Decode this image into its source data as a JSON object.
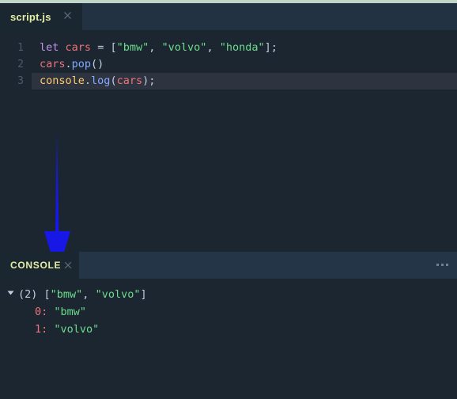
{
  "window": {
    "accent_strip_color": "#bfd6c8",
    "background_color": "#1b2631"
  },
  "editor": {
    "tab": {
      "label": "script.js",
      "close_icon": "close-icon",
      "active": true
    },
    "active_line": 3,
    "lines": [
      {
        "number": "1",
        "tokens": [
          {
            "text": "let",
            "kind": "keyword",
            "color": "#c792ea"
          },
          {
            "text": " ",
            "kind": "space"
          },
          {
            "text": "cars",
            "kind": "variable",
            "color": "#f07178"
          },
          {
            "text": " ",
            "kind": "space"
          },
          {
            "text": "=",
            "kind": "operator",
            "color": "#c3cee3"
          },
          {
            "text": " ",
            "kind": "space"
          },
          {
            "text": "[",
            "kind": "punct",
            "color": "#c3cee3"
          },
          {
            "text": "\"bmw\"",
            "kind": "string",
            "color": "#6ddc8c"
          },
          {
            "text": ",",
            "kind": "punct",
            "color": "#c3cee3"
          },
          {
            "text": " ",
            "kind": "space"
          },
          {
            "text": "\"volvo\"",
            "kind": "string",
            "color": "#6ddc8c"
          },
          {
            "text": ",",
            "kind": "punct",
            "color": "#c3cee3"
          },
          {
            "text": " ",
            "kind": "space"
          },
          {
            "text": "\"honda\"",
            "kind": "string",
            "color": "#6ddc8c"
          },
          {
            "text": "];",
            "kind": "punct",
            "color": "#c3cee3"
          }
        ]
      },
      {
        "number": "2",
        "tokens": [
          {
            "text": "cars",
            "kind": "variable",
            "color": "#f07178"
          },
          {
            "text": ".",
            "kind": "punct",
            "color": "#c3cee3"
          },
          {
            "text": "pop",
            "kind": "function",
            "color": "#82aaff"
          },
          {
            "text": "()",
            "kind": "punct",
            "color": "#c3cee3"
          }
        ]
      },
      {
        "number": "3",
        "tokens": [
          {
            "text": "console",
            "kind": "object",
            "color": "#ffcb6b"
          },
          {
            "text": ".",
            "kind": "punct",
            "color": "#c3cee3"
          },
          {
            "text": "log",
            "kind": "function",
            "color": "#82aaff"
          },
          {
            "text": "(",
            "kind": "punct",
            "color": "#c3cee3"
          },
          {
            "text": "cars",
            "kind": "variable",
            "color": "#f07178"
          },
          {
            "text": ");",
            "kind": "punct",
            "color": "#c3cee3"
          }
        ]
      }
    ]
  },
  "annotation": {
    "arrow": {
      "name": "down-arrow-annotation",
      "direction": "down",
      "color": "#1818e6"
    }
  },
  "console": {
    "tab_label": "CONSOLE",
    "close_icon": "close-icon",
    "overflow_icon": "ellipsis-icon",
    "output": {
      "summary": {
        "disclosure": "expanded",
        "count": "(2)",
        "preview_open": "[",
        "items": [
          "\"bmw\"",
          "\"volvo\""
        ],
        "separator": ", ",
        "preview_close": "]"
      },
      "entries": [
        {
          "index": "0:",
          "value": "\"bmw\""
        },
        {
          "index": "1:",
          "value": "\"volvo\""
        }
      ]
    }
  }
}
